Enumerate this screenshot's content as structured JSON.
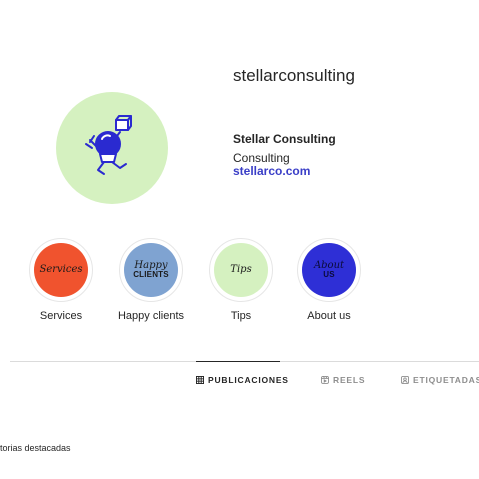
{
  "profile": {
    "username": "stellarconsulting",
    "name": "Stellar Consulting",
    "category": "Consulting",
    "link": "stellarco.com",
    "avatar_icon": "astronaut-icon",
    "avatar_bg": "#d5f1c0"
  },
  "highlights": [
    {
      "id": "services",
      "label": "Services",
      "cover_line1": "Services",
      "cover_line2": "",
      "bg": "#f0532e",
      "fg": "#1a1a1a"
    },
    {
      "id": "happy-clients",
      "label": "Happy clients",
      "cover_line1": "Happy",
      "cover_line2": "CLIENTS",
      "bg": "#7fa3d1",
      "fg": "#1a1a1a"
    },
    {
      "id": "tips",
      "label": "Tips",
      "cover_line1": "Tips",
      "cover_line2": "",
      "bg": "#d5f1c0",
      "fg": "#1a1a1a"
    },
    {
      "id": "about-us",
      "label": "About us",
      "cover_line1": "About",
      "cover_line2": "US",
      "bg": "#2e2fd6",
      "fg": "#0b0b3a"
    }
  ],
  "tabs": [
    {
      "label": "PUBLICACIONES",
      "icon": "grid-icon",
      "active": true
    },
    {
      "label": "REELS",
      "icon": "reels-icon",
      "active": false
    },
    {
      "label": "ETIQUETADAS",
      "icon": "tagged-icon",
      "active": false
    }
  ],
  "footer": {
    "text": "torias destacadas"
  },
  "colors": {
    "link": "#3a3ec7",
    "text": "#262626",
    "muted": "#8e8e8e",
    "divider": "#dbdbdb"
  }
}
